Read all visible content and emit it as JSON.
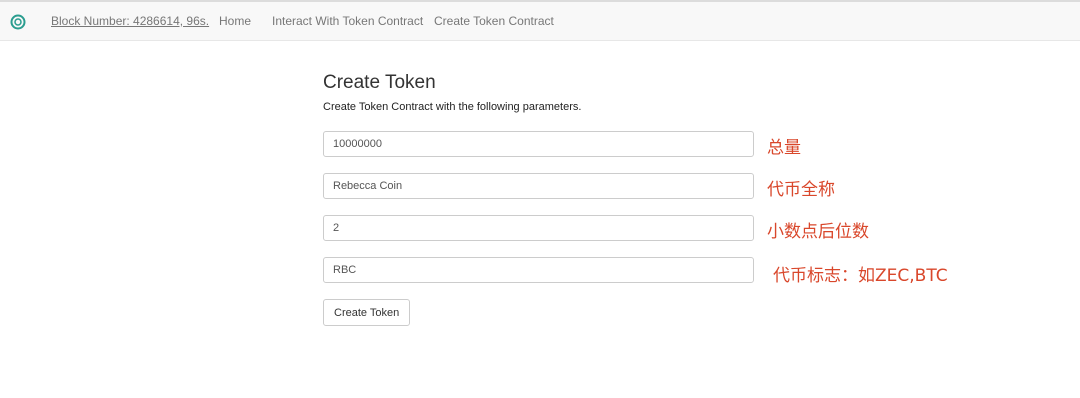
{
  "navbar": {
    "logo_icon": "circle-logo-icon",
    "accent": "#2a9d8f",
    "block_number": "Block Number: 4286614, 96s.",
    "links": [
      "Home",
      "Interact With Token Contract",
      "Create Token Contract"
    ]
  },
  "main": {
    "title": "Create Token",
    "subtitle": "Create Token Contract with the following parameters.",
    "fields": [
      {
        "value": "10000000",
        "note": "总量"
      },
      {
        "value": "Rebecca Coin",
        "note": "代币全称"
      },
      {
        "value": "2",
        "note": "小数点后位数"
      },
      {
        "value": "RBC",
        "note": "代币标志：如ZEC,BTC"
      }
    ],
    "submit_label": "Create Token"
  },
  "colors": {
    "note_red": "#d9472b",
    "navbar_bg": "#f8f8f8"
  }
}
